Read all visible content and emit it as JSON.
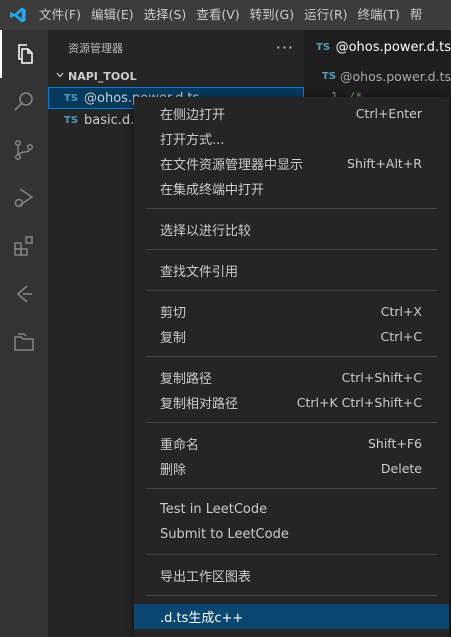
{
  "menubar": {
    "items": [
      "文件(F)",
      "编辑(E)",
      "选择(S)",
      "查看(V)",
      "转到(G)",
      "运行(R)",
      "终端(T)",
      "帮"
    ]
  },
  "activity": {
    "icons": [
      "files-icon",
      "search-icon",
      "source-control-icon",
      "run-debug-icon",
      "extensions-icon",
      "leetcode-icon",
      "folder-icon"
    ]
  },
  "sidebar": {
    "title": "资源管理器",
    "more": "···",
    "section": "NAPI_TOOL",
    "files": [
      {
        "badge": "TS",
        "name": "@ohos.power.d.ts"
      },
      {
        "badge": "TS",
        "name": "basic.d.ts"
      }
    ]
  },
  "editor": {
    "tab": {
      "badge": "TS",
      "name": "@ohos.power.d.ts"
    },
    "breadcrumb": {
      "badge": "TS",
      "name": "@ohos.power.d.ts"
    },
    "line1": {
      "number": "1",
      "text": "/*"
    }
  },
  "context_menu": {
    "groups": [
      [
        {
          "label": "在侧边打开",
          "shortcut": "Ctrl+Enter"
        },
        {
          "label": "打开方式...",
          "shortcut": ""
        },
        {
          "label": "在文件资源管理器中显示",
          "shortcut": "Shift+Alt+R"
        },
        {
          "label": "在集成终端中打开",
          "shortcut": ""
        }
      ],
      [
        {
          "label": "选择以进行比较",
          "shortcut": ""
        }
      ],
      [
        {
          "label": "查找文件引用",
          "shortcut": ""
        }
      ],
      [
        {
          "label": "剪切",
          "shortcut": "Ctrl+X"
        },
        {
          "label": "复制",
          "shortcut": "Ctrl+C"
        }
      ],
      [
        {
          "label": "复制路径",
          "shortcut": "Ctrl+Shift+C"
        },
        {
          "label": "复制相对路径",
          "shortcut": "Ctrl+K Ctrl+Shift+C"
        }
      ],
      [
        {
          "label": "重命名",
          "shortcut": "Shift+F6"
        },
        {
          "label": "删除",
          "shortcut": "Delete"
        }
      ],
      [
        {
          "label": "Test in LeetCode",
          "shortcut": ""
        },
        {
          "label": "Submit to LeetCode",
          "shortcut": ""
        }
      ],
      [
        {
          "label": "导出工作区图表",
          "shortcut": ""
        }
      ],
      [
        {
          "label": ".d.ts生成c++",
          "shortcut": ""
        }
      ]
    ],
    "highlighted": ".d.ts生成c++"
  },
  "colors": {
    "accent": "#007acc",
    "menu_highlight": "#094771",
    "ts_badge": "#519aba"
  }
}
